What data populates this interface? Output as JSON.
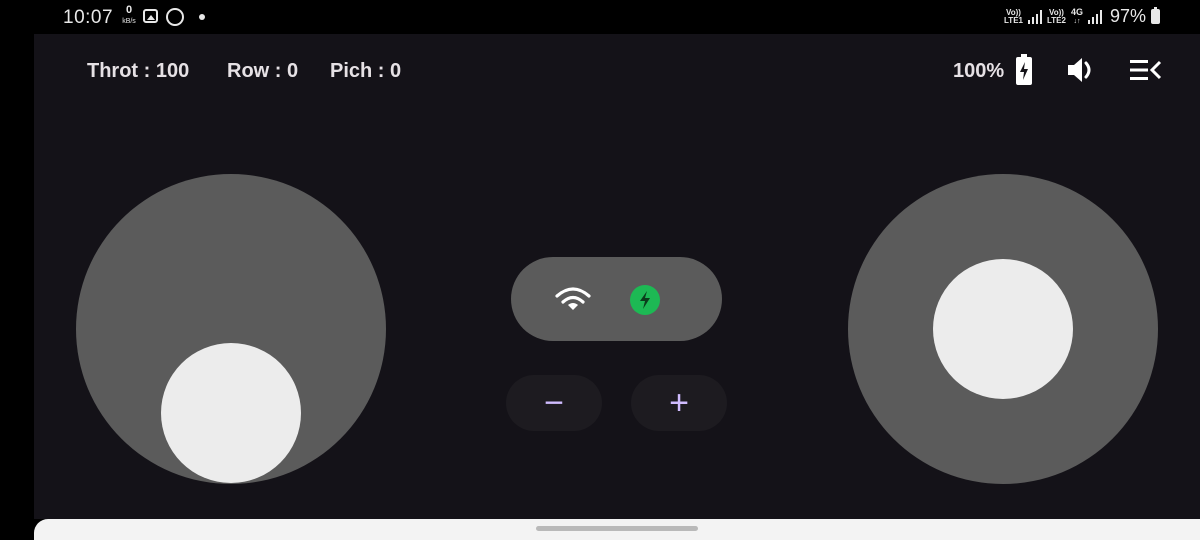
{
  "status_bar": {
    "time": "10:07",
    "net_speed_value": "0",
    "net_speed_unit": "kB/s",
    "sim1_line1": "Vo))",
    "sim1_line2": "LTE1",
    "sim2_line1": "Vo))",
    "sim2_line2": "LTE2",
    "net_type": "4G",
    "battery_percent": "97%"
  },
  "hud": {
    "throttle": "Throt : 100",
    "roll": "Row : 0",
    "pitch": "Pich : 0",
    "battery": "100%"
  },
  "controls": {
    "minus_label": "−",
    "plus_label": "+"
  },
  "colors": {
    "app_background": "#141218",
    "joystick_base": "#5b5b5b",
    "joystick_knob": "#ececec",
    "connected_badge": "#1db954",
    "accent": "#d0bcff"
  }
}
